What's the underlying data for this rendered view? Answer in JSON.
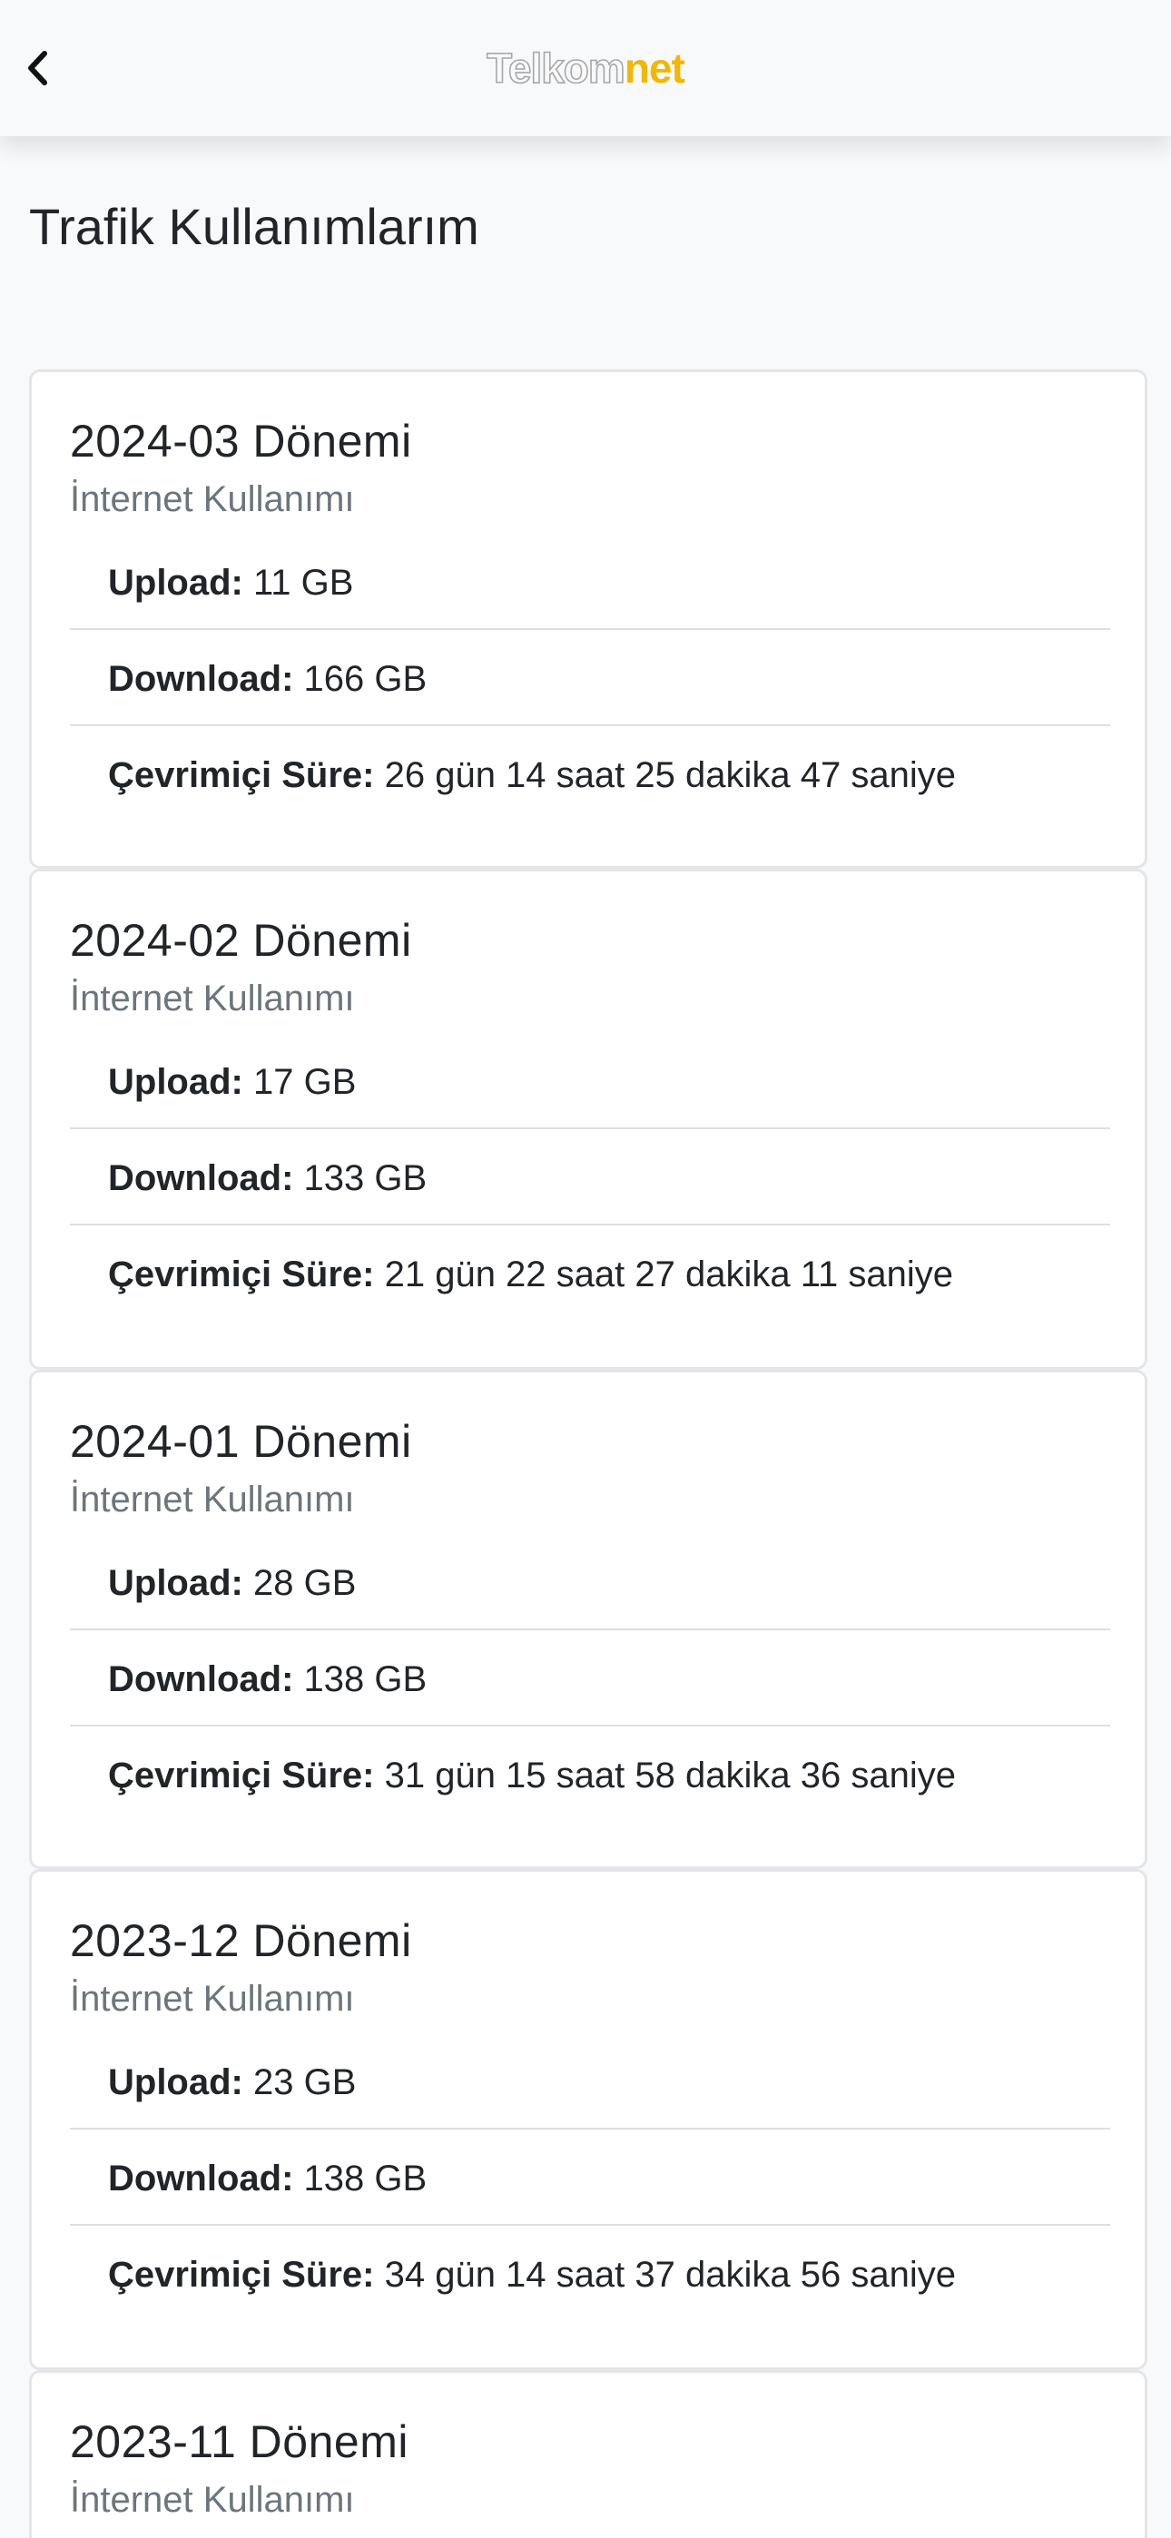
{
  "header": {
    "back_icon": "chevron-left-icon",
    "logo_part1": "Telkom",
    "logo_part2": "net",
    "logo_accent_color": "#f2b705"
  },
  "page": {
    "title": "Trafik Kullanımlarım"
  },
  "periods": [
    {
      "title": "2024-03 Dönemi",
      "subtitle": "İnternet Kullanımı",
      "upload_label": "Upload:",
      "upload_value": "11 GB",
      "download_label": "Download:",
      "download_value": "166 GB",
      "online_label": "Çevrimiçi Süre:",
      "online_value": "26 gün 14 saat 25 dakika 47 saniye"
    },
    {
      "title": "2024-02 Dönemi",
      "subtitle": "İnternet Kullanımı",
      "upload_label": "Upload:",
      "upload_value": "17 GB",
      "download_label": "Download:",
      "download_value": "133 GB",
      "online_label": "Çevrimiçi Süre:",
      "online_value": "21 gün 22 saat 27 dakika 11 saniye"
    },
    {
      "title": "2024-01 Dönemi",
      "subtitle": "İnternet Kullanımı",
      "upload_label": "Upload:",
      "upload_value": "28 GB",
      "download_label": "Download:",
      "download_value": "138 GB",
      "online_label": "Çevrimiçi Süre:",
      "online_value": "31 gün 15 saat 58 dakika 36 saniye"
    },
    {
      "title": "2023-12 Dönemi",
      "subtitle": "İnternet Kullanımı",
      "upload_label": "Upload:",
      "upload_value": "23 GB",
      "download_label": "Download:",
      "download_value": "138 GB",
      "online_label": "Çevrimiçi Süre:",
      "online_value": "34 gün 14 saat 37 dakika 56 saniye"
    },
    {
      "title": "2023-11 Dönemi",
      "subtitle": "İnternet Kullanımı"
    }
  ]
}
